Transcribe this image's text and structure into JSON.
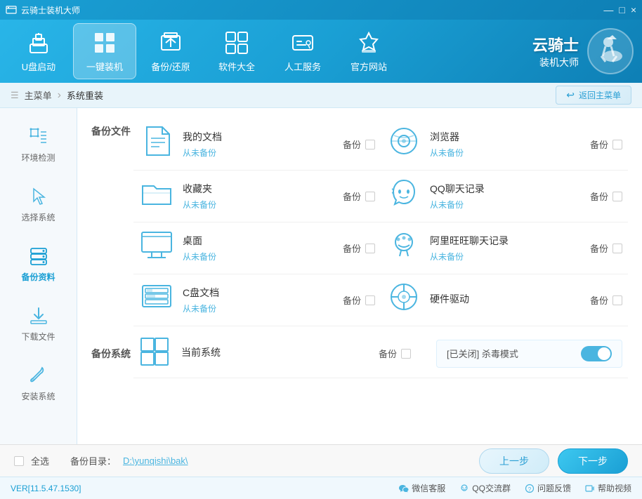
{
  "titleBar": {
    "title": "云骑士装机大师",
    "controls": [
      "—",
      "□",
      "×"
    ]
  },
  "nav": {
    "items": [
      {
        "id": "usb",
        "label": "U盘启动",
        "icon": "usb"
      },
      {
        "id": "onekey",
        "label": "一键装机",
        "icon": "windows",
        "active": true
      },
      {
        "id": "backup",
        "label": "备份/还原",
        "icon": "backup"
      },
      {
        "id": "software",
        "label": "软件大全",
        "icon": "apps"
      },
      {
        "id": "service",
        "label": "人工服务",
        "icon": "service"
      },
      {
        "id": "website",
        "label": "官方网站",
        "icon": "website"
      }
    ],
    "brand": {
      "main": "云骑士",
      "sub": "装机大师"
    },
    "backBtn": "返回主菜单"
  },
  "breadcrumb": {
    "root": "主菜单",
    "current": "系统重装",
    "backLabel": "返回主菜单"
  },
  "sidebar": {
    "items": [
      {
        "id": "env",
        "label": "环境检测",
        "icon": "gear"
      },
      {
        "id": "selectsys",
        "label": "选择系统",
        "icon": "cursor"
      },
      {
        "id": "backupdata",
        "label": "备份资料",
        "icon": "database",
        "active": true
      },
      {
        "id": "download",
        "label": "下载文件",
        "icon": "download"
      },
      {
        "id": "install",
        "label": "安装系统",
        "icon": "wrench"
      }
    ]
  },
  "backupFiles": {
    "sectionLabel": "备份文件",
    "items": [
      {
        "name": "我的文档",
        "status": "从未备份",
        "actionLabel": "备份"
      },
      {
        "name": "浏览器",
        "status": "从未备份",
        "actionLabel": "备份"
      },
      {
        "name": "收藏夹",
        "status": "从未备份",
        "actionLabel": "备份"
      },
      {
        "name": "QQ聊天记录",
        "status": "从未备份",
        "actionLabel": "备份"
      },
      {
        "name": "桌面",
        "status": "从未备份",
        "actionLabel": "备份"
      },
      {
        "name": "阿里旺旺聊天记录",
        "status": "从未备份",
        "actionLabel": "备份"
      },
      {
        "name": "C盘文档",
        "status": "从未备份",
        "actionLabel": "备份"
      },
      {
        "name": "硬件驱动",
        "status": "",
        "actionLabel": "备份"
      }
    ]
  },
  "backupSystem": {
    "sectionLabel": "备份系统",
    "item": {
      "name": "当前系统",
      "actionLabel": "备份"
    },
    "antivirus": {
      "label": "[已关闭] 杀毒模式",
      "toggleOn": true
    }
  },
  "bottomBar": {
    "selectAllLabel": "全选",
    "dirLabel": "备份目录：",
    "dirPath": "D:\\yunqishi\\bak\\",
    "prevBtn": "上一步",
    "nextBtn": "下一步"
  },
  "footer": {
    "version": "VER[11.5.47.1530]",
    "links": [
      {
        "icon": "wechat",
        "label": "微信客服"
      },
      {
        "icon": "qq",
        "label": "QQ交流群"
      },
      {
        "icon": "feedback",
        "label": "问题反馈"
      },
      {
        "icon": "video",
        "label": "帮助视频"
      }
    ]
  }
}
